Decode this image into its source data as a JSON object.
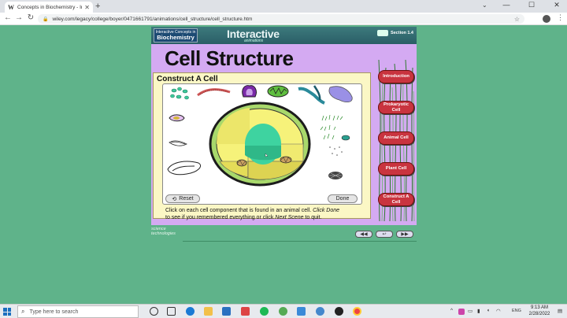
{
  "browser": {
    "tab_title": "Concepts in Biochemistry - Intera",
    "tab_icon": "W",
    "new_tab": "+",
    "url": "wiley.com/legacy/college/boyer/0471661791/animations/cell_structure/cell_structure.htm",
    "window_buttons": [
      "—",
      "☐",
      "✕"
    ]
  },
  "app": {
    "book_logo_small": "Interactive Concepts in",
    "book_logo_big": "Biochemistry",
    "header_title": "Interactive",
    "header_sub": "animations",
    "section": "Section 1.4",
    "title": "Cell Structure",
    "panel_title": "Construct  A Cell",
    "reset_label": "Reset",
    "done_label": "Done",
    "instr_1": "Click on each cell component that is found in an animal cell.  ",
    "instr_done": "Click Done",
    "instr_2": "to see if you remembered everything or click ",
    "instr_next": "Next Scene",
    "instr_3": " to quit.",
    "side_buttons": [
      "Introduction",
      "Prokaryotic Cell",
      "Animal Cell",
      "Plant Cell",
      "Construct A Cell"
    ],
    "footer_logo": "science technologies",
    "nav_buttons": [
      "◀◀",
      "↩",
      "▶▶"
    ]
  },
  "taskbar": {
    "search_placeholder": "Type here to search",
    "lang": "ENG",
    "time": "9:13 AM",
    "date": "2/28/2022"
  },
  "colors": {
    "background": "#5fb38a",
    "stage": "#d4aaf2",
    "panel": "#fbf7c5",
    "side_button": "#c9343f",
    "cell_membrane": "#1c1c1c",
    "cytoplasm_green": "#a8d86b",
    "nucleus": "#3ed3a0"
  }
}
